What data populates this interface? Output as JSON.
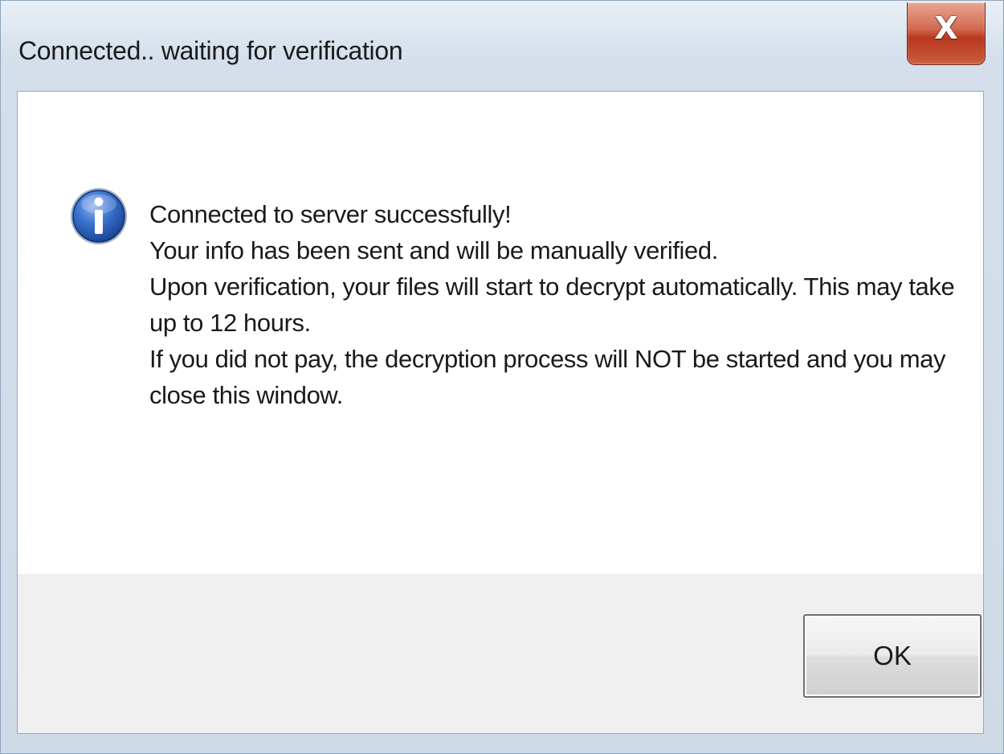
{
  "window": {
    "title": "Connected.. waiting for verification",
    "close_label": "X"
  },
  "dialog": {
    "icon": "info-icon",
    "lines": [
      "Connected to server successfully!",
      "Your info has been sent and will be manually verified.",
      "Upon verification, your files will start to decrypt automatically. This may take up to 12 hours.",
      "If you did not pay, the decryption process will NOT be started and you may close this window."
    ]
  },
  "buttons": {
    "ok_label": "OK"
  },
  "colors": {
    "close_button": "#c84a2e",
    "info_icon": "#2a66c4",
    "footer_background": "#f0f0f0"
  }
}
